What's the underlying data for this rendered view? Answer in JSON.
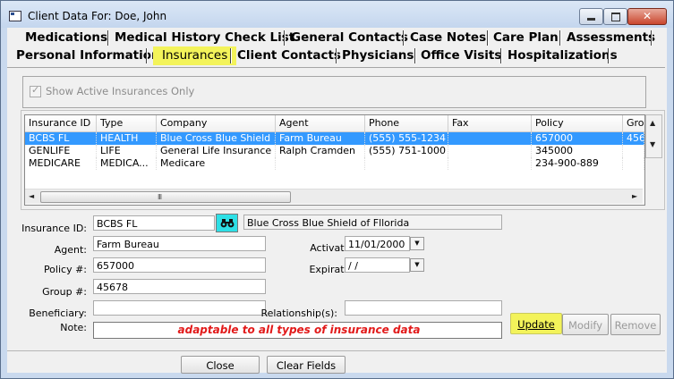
{
  "window": {
    "title": "Client Data For: Doe, John"
  },
  "tabs": {
    "row1": [
      "Medications",
      "Medical History Check List",
      "General Contacts",
      "Case Notes",
      "Care Plan",
      "Assessments"
    ],
    "row2": [
      "Personal Information",
      "Insurances",
      "Client Contacts",
      "Physicians",
      "Office Visits",
      "Hospitalizations"
    ],
    "active": "Insurances"
  },
  "filter": {
    "show_active_label": "Show Active Insurances Only",
    "show_active_checked": true
  },
  "grid": {
    "columns": [
      "Insurance ID",
      "Type",
      "Company",
      "Agent",
      "Phone",
      "Fax",
      "Policy",
      "Gro"
    ],
    "rows": [
      [
        "BCBS FL",
        "HEALTH",
        "Blue Cross Blue Shield ...",
        "Farm Bureau",
        "(555) 555-1234",
        "",
        "657000",
        "456"
      ],
      [
        "GENLIFE",
        "LIFE",
        "General Life Insurance ...",
        "Ralph Cramden",
        "(555) 751-1000",
        "",
        "345000",
        ""
      ],
      [
        "MEDICARE",
        "MEDICA...",
        "Medicare",
        "",
        "",
        "",
        "234-900-889",
        ""
      ]
    ],
    "selected_row": 0,
    "hscroll_grip": "III"
  },
  "form": {
    "insurance_id_label": "Insurance ID:",
    "insurance_id_value": "BCBS FL",
    "company_value": "Blue Cross Blue Shield of Fllorida",
    "agent_label": "Agent:",
    "agent_value": "Farm Bureau",
    "policy_label": "Policy #:",
    "policy_value": "657000",
    "group_label": "Group #:",
    "group_value": "45678",
    "beneficiary_label": "Beneficiary:",
    "beneficiary_value": "",
    "note_label": "Note:",
    "note_value": "",
    "activation_label": "Activation:",
    "activation_value": "11/01/2000",
    "expiration_label": "Expiration:",
    "expiration_value": " /  /",
    "relationship_label": "Relationship(s):",
    "relationship_value": ""
  },
  "annotation": "adaptable to all types of insurance data",
  "buttons": {
    "update": "Update",
    "modify": "Modify",
    "remove": "Remove",
    "close": "Close",
    "clear_fields": "Clear Fields"
  },
  "colors": {
    "highlight": "#f3f35a",
    "selection": "#3399ff",
    "annotation": "#e21a1a",
    "lookup_button": "#2ee0e6"
  }
}
